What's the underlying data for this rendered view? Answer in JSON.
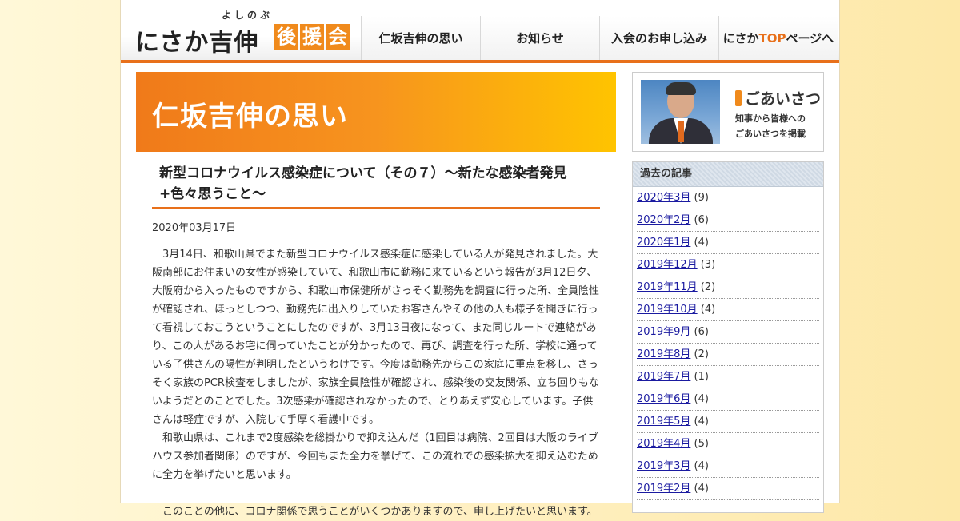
{
  "logo": {
    "ruby": "よしのぶ",
    "main": "にさか吉伸",
    "boxes": [
      "後",
      "援",
      "会"
    ]
  },
  "nav": [
    {
      "label": "仁坂吉伸の思い"
    },
    {
      "label": "お知らせ"
    },
    {
      "label": "入会のお申し込み"
    },
    {
      "label_prefix": "にさか",
      "label_highlight": "TOP",
      "label_suffix": "ページへ"
    }
  ],
  "banner": {
    "title": "仁坂吉伸の思い"
  },
  "article": {
    "title": "新型コロナウイルス感染症について（その７）～新たな感染者発見+色々思うこと～",
    "date": "2020年03月17日",
    "paragraphs": [
      "3月14日、和歌山県でまた新型コロナウイルス感染症に感染している人が発見されました。大阪南部にお住まいの女性が感染していて、和歌山市に勤務に来ているという報告が3月12日夕、大阪府から入ったものですから、和歌山市保健所がさっそく勤務先を調査に行った所、全員陰性が確認され、ほっとしつつ、勤務先に出入りしていたお客さんやその他の人も様子を聞きに行って看視しておこうということにしたのですが、3月13日夜になって、また同じルートで連絡があり、この人があるお宅に伺っていたことが分かったので、再び、調査を行った所、学校に通っている子供さんの陽性が判明したというわけです。今度は勤務先からこの家庭に重点を移し、さっそく家族のPCR検査をしましたが、家族全員陰性が確認され、感染後の交友関係、立ち回りもないようだとのことでした。3次感染が確認されなかったので、とりあえず安心しています。子供さんは軽症ですが、入院して手厚く看護中です。",
      "和歌山県は、これまで2度感染を総掛かりで抑え込んだ（1回目は病院、2回目は大阪のライブハウス参加者関係）のですが、今回もまた全力を挙げて、この流れでの感染拡大を抑え込むために全力を挙げたいと思います。",
      "このことの他に、コロナ関係で思うことがいくつかありますので、申し上げたいと思います。"
    ]
  },
  "greeting": {
    "title": "ごあいさつ",
    "sub1": "知事から皆様への",
    "sub2": "ごあいさつを掲載"
  },
  "archive": {
    "header": "過去の記事",
    "items": [
      {
        "label": "2020年3月",
        "count": "(9)"
      },
      {
        "label": "2020年2月",
        "count": "(6)"
      },
      {
        "label": "2020年1月",
        "count": "(4)"
      },
      {
        "label": "2019年12月",
        "count": "(3)"
      },
      {
        "label": "2019年11月",
        "count": "(2)"
      },
      {
        "label": "2019年10月",
        "count": "(4)"
      },
      {
        "label": "2019年9月",
        "count": "(6)"
      },
      {
        "label": "2019年8月",
        "count": "(2)"
      },
      {
        "label": "2019年7月",
        "count": "(1)"
      },
      {
        "label": "2019年6月",
        "count": "(4)"
      },
      {
        "label": "2019年5月",
        "count": "(4)"
      },
      {
        "label": "2019年4月",
        "count": "(5)"
      },
      {
        "label": "2019年3月",
        "count": "(4)"
      },
      {
        "label": "2019年2月",
        "count": "(4)"
      }
    ]
  },
  "colors": {
    "accent": "#e8701a",
    "banner_start": "#f07a1a",
    "banner_end": "#ffc400",
    "link": "#1a1aa0"
  }
}
